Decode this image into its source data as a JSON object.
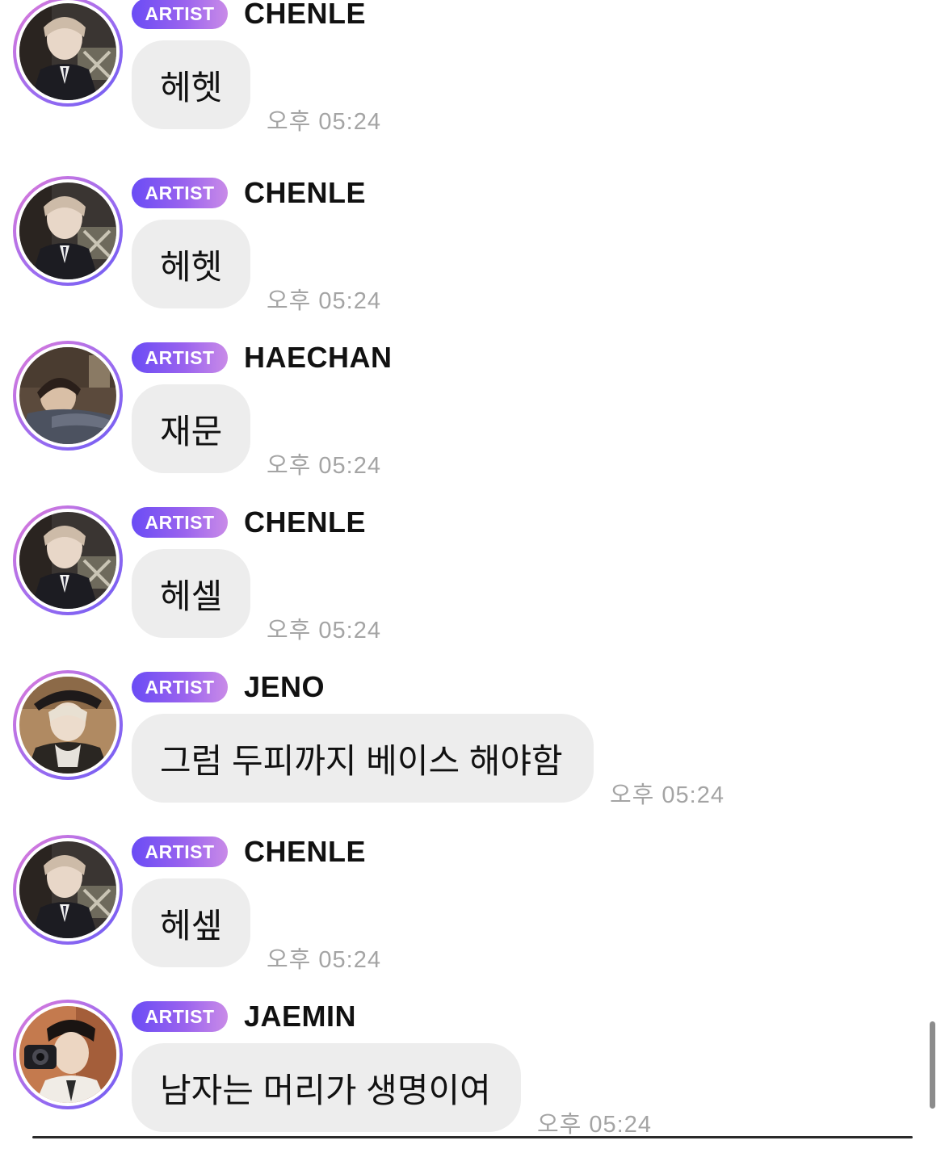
{
  "chat": {
    "messages": [
      {
        "badge": "ARTIST",
        "sender": "CHENLE",
        "text": "헤헷",
        "time": "오후 05:24",
        "avatar": "chenle-avatar"
      },
      {
        "badge": "ARTIST",
        "sender": "CHENLE",
        "text": "헤헷",
        "time": "오후 05:24",
        "avatar": "chenle-avatar"
      },
      {
        "badge": "ARTIST",
        "sender": "HAECHAN",
        "text": "재문",
        "time": "오후 05:24",
        "avatar": "haechan-avatar"
      },
      {
        "badge": "ARTIST",
        "sender": "CHENLE",
        "text": "헤셀",
        "time": "오후 05:24",
        "avatar": "chenle-avatar"
      },
      {
        "badge": "ARTIST",
        "sender": "JENO",
        "text": "그럼 두피까지 베이스 해야함",
        "time": "오후 05:24",
        "avatar": "jeno-avatar"
      },
      {
        "badge": "ARTIST",
        "sender": "CHENLE",
        "text": "헤셒",
        "time": "오후 05:24",
        "avatar": "chenle-avatar"
      },
      {
        "badge": "ARTIST",
        "sender": "JAEMIN",
        "text": "남자는 머리가 생명이여",
        "time": "오후 05:24",
        "avatar": "jaemin-avatar"
      }
    ]
  },
  "colors": {
    "badge_gradient_start": "#6a4cf5",
    "badge_gradient_end": "#c98be8",
    "bubble_bg": "#ededed",
    "timestamp": "#a4a4a4"
  }
}
